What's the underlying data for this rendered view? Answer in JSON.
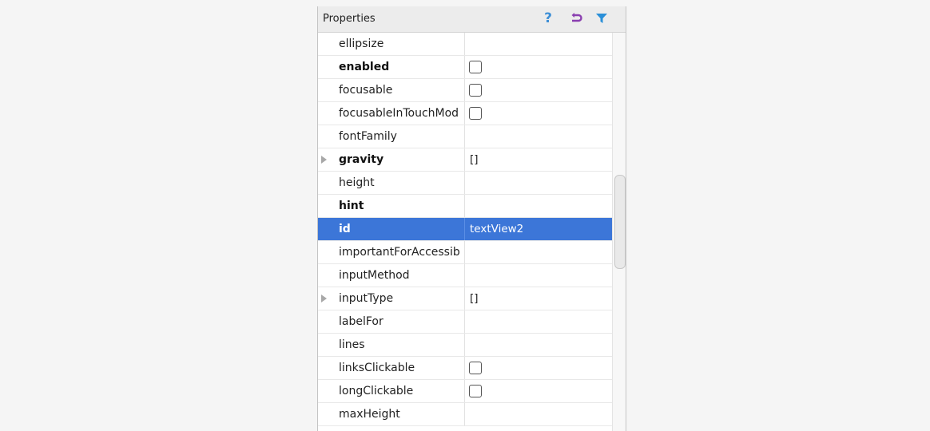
{
  "panel": {
    "title": "Properties",
    "icons": {
      "help": "help-icon",
      "undo": "undo-icon",
      "filter": "filter-icon"
    },
    "colors": {
      "help": "#3d8fd6",
      "undo": "#8a3fb0",
      "filter": "#2a8fd8",
      "selected_row": "#3c76d8"
    }
  },
  "rows": [
    {
      "name": "ellipsize",
      "bold": false,
      "expandable": false,
      "value": "",
      "checkbox": false
    },
    {
      "name": "enabled",
      "bold": true,
      "expandable": false,
      "value": "",
      "checkbox": true
    },
    {
      "name": "focusable",
      "bold": false,
      "expandable": false,
      "value": "",
      "checkbox": true
    },
    {
      "name": "focusableInTouchMod",
      "bold": false,
      "expandable": false,
      "value": "",
      "checkbox": true
    },
    {
      "name": "fontFamily",
      "bold": false,
      "expandable": false,
      "value": "",
      "checkbox": false
    },
    {
      "name": "gravity",
      "bold": true,
      "expandable": true,
      "value": "[]",
      "checkbox": false
    },
    {
      "name": "height",
      "bold": false,
      "expandable": false,
      "value": "",
      "checkbox": false
    },
    {
      "name": "hint",
      "bold": true,
      "expandable": false,
      "value": "",
      "checkbox": false
    },
    {
      "name": "id",
      "bold": true,
      "expandable": false,
      "value": "textView2",
      "checkbox": false,
      "selected": true
    },
    {
      "name": "importantForAccessib",
      "bold": false,
      "expandable": false,
      "value": "",
      "checkbox": false
    },
    {
      "name": "inputMethod",
      "bold": false,
      "expandable": false,
      "value": "",
      "checkbox": false
    },
    {
      "name": "inputType",
      "bold": false,
      "expandable": true,
      "value": "[]",
      "checkbox": false
    },
    {
      "name": "labelFor",
      "bold": false,
      "expandable": false,
      "value": "",
      "checkbox": false
    },
    {
      "name": "lines",
      "bold": false,
      "expandable": false,
      "value": "",
      "checkbox": false
    },
    {
      "name": "linksClickable",
      "bold": false,
      "expandable": false,
      "value": "",
      "checkbox": true
    },
    {
      "name": "longClickable",
      "bold": false,
      "expandable": false,
      "value": "",
      "checkbox": true
    },
    {
      "name": "maxHeight",
      "bold": false,
      "expandable": false,
      "value": "",
      "checkbox": false
    }
  ]
}
